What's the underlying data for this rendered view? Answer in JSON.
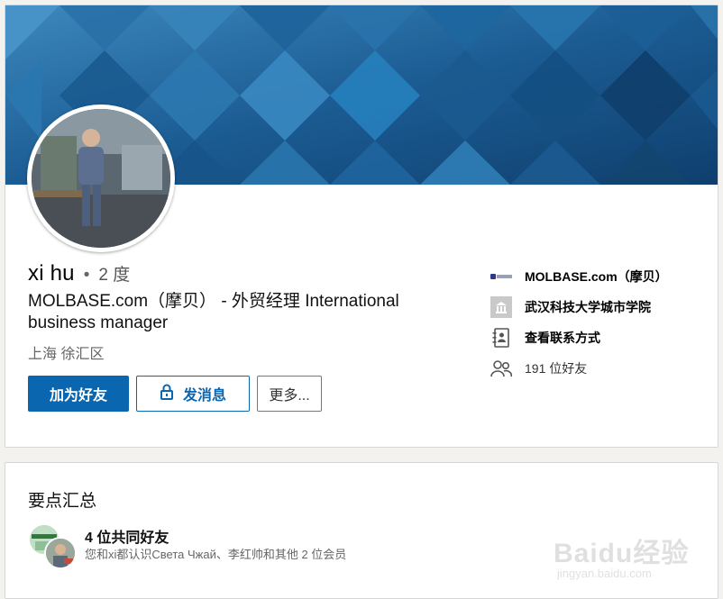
{
  "profile": {
    "name": "xi hu",
    "degree": "2 度",
    "bullet": "•",
    "headline": "MOLBASE.com（摩贝） - 外贸经理 International business manager",
    "location": "上海 徐汇区",
    "buttons": {
      "connect": "加为好友",
      "message": "发消息",
      "more": "更多..."
    },
    "side": {
      "company": "MOLBASE.com（摩贝）",
      "school": "武汉科技大学城市学院",
      "contact": "查看联系方式",
      "connections": "191 位好友"
    },
    "icons": {
      "company": "company-logo-icon",
      "school": "school-icon",
      "contact": "contact-card-icon",
      "connections": "people-icon",
      "lock": "lock-icon"
    }
  },
  "highlights": {
    "title": "要点汇总",
    "mutual_title": "4 位共同好友",
    "mutual_desc": "您和xi都认识Света Чжай、李红帅和其他 2 位会员"
  },
  "watermark": {
    "brand": "Baidu经验",
    "url": "jingyan.baidu.com"
  },
  "colors": {
    "accent": "#0b66b0",
    "banner": "#1d5d92"
  }
}
